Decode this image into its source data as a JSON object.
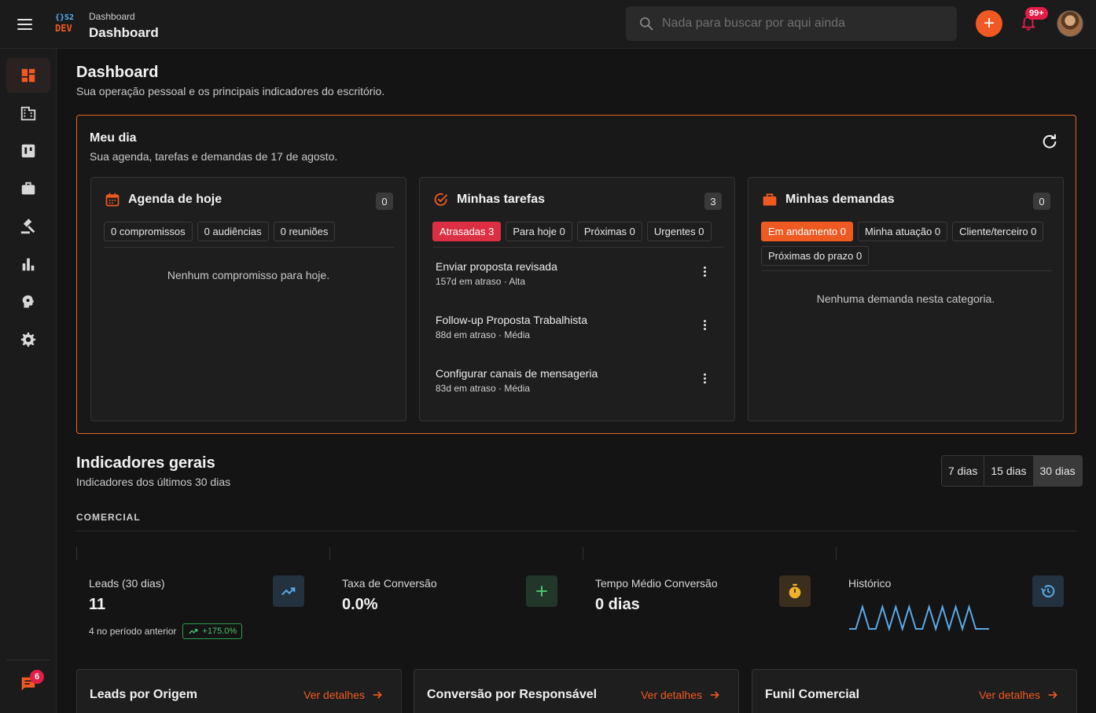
{
  "header": {
    "logo_top": "{}S2",
    "logo_bottom": "DEV",
    "breadcrumb": "Dashboard",
    "title": "Dashboard",
    "search_placeholder": "Nada para buscar por aqui ainda",
    "notifications_badge": "99+",
    "add_label": "+"
  },
  "sidebar": {
    "items": [
      {
        "icon": "dashboard-icon",
        "active": true
      },
      {
        "icon": "building-icon"
      },
      {
        "icon": "kanban-icon"
      },
      {
        "icon": "briefcase-icon"
      },
      {
        "icon": "gavel-icon"
      },
      {
        "icon": "bar-chart-icon"
      },
      {
        "icon": "brain-settings-icon"
      },
      {
        "icon": "gear-icon"
      }
    ],
    "chat_badge": "6"
  },
  "page": {
    "title": "Dashboard",
    "subtitle": "Sua operação pessoal e os principais indicadores do escritório."
  },
  "meu_dia": {
    "title": "Meu dia",
    "subtitle": "Sua agenda, tarefas e demandas de 17 de agosto.",
    "agenda": {
      "title": "Agenda de hoje",
      "count": "0",
      "chips": [
        "0 compromissos",
        "0 audiências",
        "0 reuniões"
      ],
      "empty": "Nenhum compromisso para hoje."
    },
    "tarefas": {
      "title": "Minhas tarefas",
      "count": "3",
      "chips": [
        "Atrasadas 3",
        "Para hoje 0",
        "Próximas 0",
        "Urgentes 0"
      ],
      "items": [
        {
          "title": "Enviar proposta revisada",
          "meta": "157d em atraso · Alta"
        },
        {
          "title": "Follow-up Proposta Trabalhista",
          "meta": "88d em atraso · Média"
        },
        {
          "title": "Configurar canais de mensageria",
          "meta": "83d em atraso · Média"
        }
      ]
    },
    "demandas": {
      "title": "Minhas demandas",
      "count": "0",
      "chips": [
        "Em andamento 0",
        "Minha atuação 0",
        "Cliente/terceiro 0",
        "Próximas do prazo 0"
      ],
      "empty": "Nenhuma demanda nesta categoria."
    }
  },
  "indicadores": {
    "title": "Indicadores gerais",
    "subtitle": "Indicadores dos últimos 30 dias",
    "ranges": [
      "7 dias",
      "15 dias",
      "30 dias"
    ],
    "selected_range": "30 dias",
    "section": "COMERCIAL",
    "kpis": [
      {
        "label": "Leads (30 dias)",
        "value": "11",
        "prev": "4 no período anterior",
        "trend": "+175.0%",
        "icon": "trending-up-icon",
        "icon_bg": "#24313f",
        "icon_color": "#5aa9e6"
      },
      {
        "label": "Taxa de Conversão",
        "value": "0.0%",
        "icon": "plus-icon",
        "icon_bg": "#22372a",
        "icon_color": "#4cc26e"
      },
      {
        "label": "Tempo Médio Conversão",
        "value": "0 dias",
        "icon": "stopwatch-icon",
        "icon_bg": "#3a2f1f",
        "icon_color": "#f2b12a"
      },
      {
        "label": "Histórico",
        "icon": "history-icon",
        "icon_bg": "#24313f",
        "icon_color": "#5aa9e6",
        "sparkline": [
          0,
          0,
          1,
          0,
          0,
          1,
          0,
          1,
          0,
          1,
          0,
          0,
          1,
          0,
          1,
          0,
          1,
          0,
          1,
          0,
          0,
          0
        ]
      }
    ]
  },
  "bottom_cards": [
    {
      "title": "Leads por Origem",
      "link": "Ver detalhes"
    },
    {
      "title": "Conversão por Responsável",
      "link": "Ver detalhes"
    },
    {
      "title": "Funil Comercial",
      "link": "Ver detalhes"
    }
  ]
}
